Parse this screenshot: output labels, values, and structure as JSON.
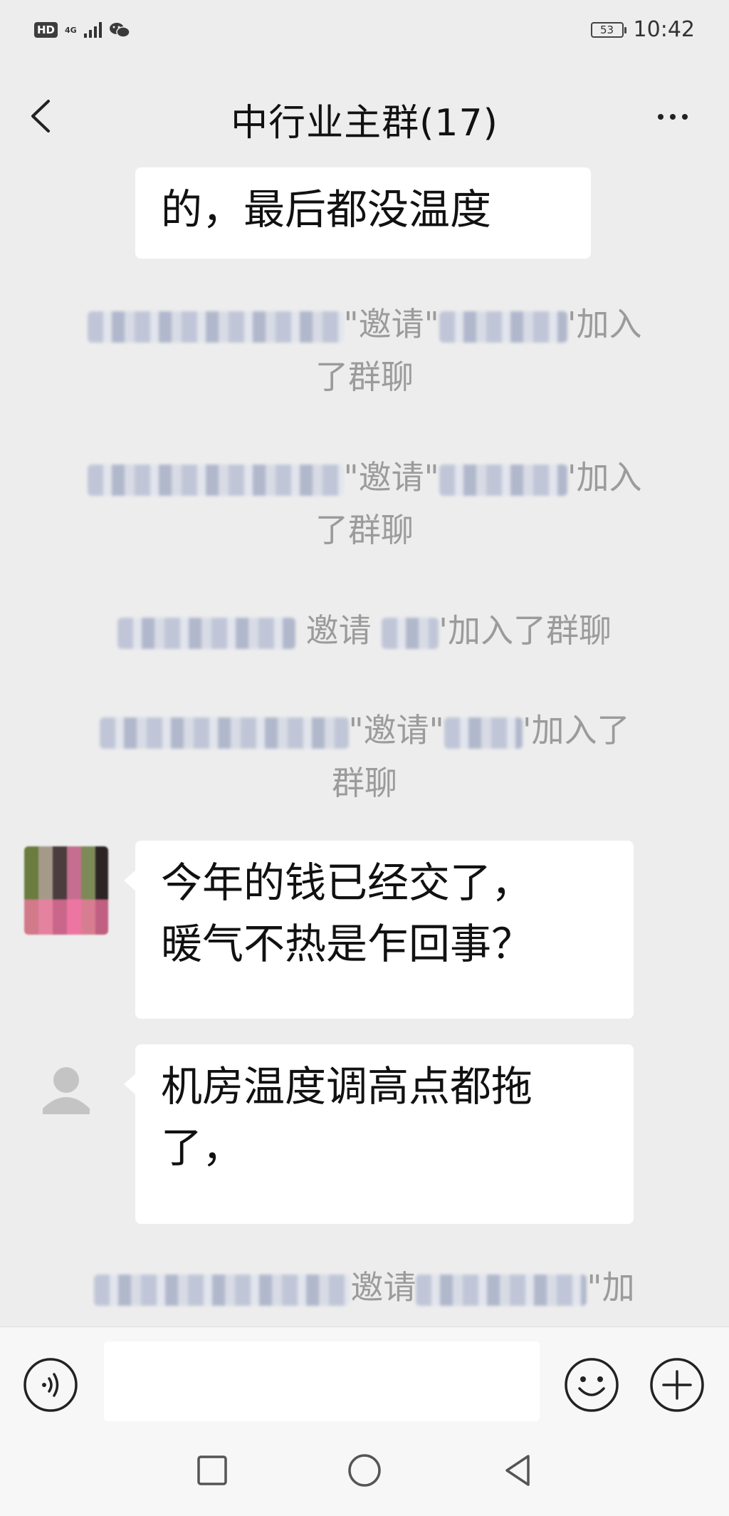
{
  "status_bar": {
    "hd_label": "HD",
    "network_label": "4G",
    "battery_level": "53",
    "time": "10:42",
    "icons": [
      "hd-icon",
      "signal-icon",
      "wechat-icon",
      "battery-icon"
    ]
  },
  "header": {
    "title": "中行业主群(17)",
    "back_icon": "chevron-left-icon",
    "more_icon": "more-horizontal-icon"
  },
  "messages": [
    {
      "type": "bubble",
      "text": "的，最后都没温度"
    },
    {
      "type": "system",
      "line1_a": "\"邀请\"",
      "line1_b": "'加入",
      "line2": "了群聊"
    },
    {
      "type": "system",
      "line1_a": "\"邀请\"",
      "line1_b": "'加入",
      "line2": "了群聊"
    },
    {
      "type": "system",
      "line1_a": "邀请",
      "line1_b": "'加入了群聊"
    },
    {
      "type": "system",
      "line1_a": "\"邀请\"",
      "line1_b": "'加入了",
      "line2": "群聊"
    },
    {
      "type": "bubble",
      "avatar": "photo",
      "line1": "今年的钱已经交了，",
      "line2": "暖气不热是乍回事？"
    },
    {
      "type": "bubble",
      "avatar": "default-user",
      "line1": "机房温度调高点都拖",
      "line2": "了，"
    },
    {
      "type": "system",
      "line1_a": "邀请",
      "line1_b": "\"加"
    }
  ],
  "input_bar": {
    "voice_icon": "voice-icon",
    "input_value": "",
    "emoji_icon": "emoji-icon",
    "plus_icon": "plus-circle-icon"
  },
  "nav_bar": {
    "icons": [
      "recent-apps-icon",
      "home-icon",
      "back-triangle-icon"
    ]
  },
  "colors": {
    "background": "#ededed",
    "bubble": "#ffffff",
    "system_text": "#9b9b9b",
    "title_text": "#111111"
  }
}
